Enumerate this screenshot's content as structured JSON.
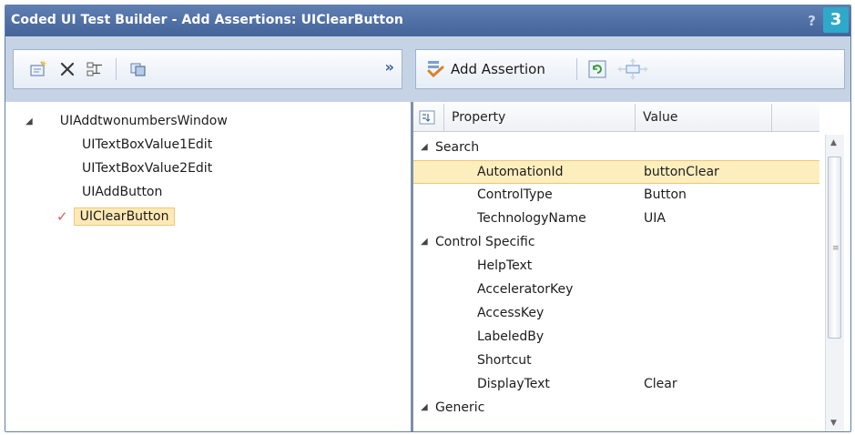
{
  "window": {
    "title": "Coded UI Test Builder - Add Assertions: UIClearButton",
    "help_label": "?",
    "step_badge": "3"
  },
  "toolbar": {
    "overflow_label": "»",
    "add_assertion_label": "Add Assertion"
  },
  "tree": {
    "root": {
      "label": "UIAddtwonumbersWindow",
      "expander": "◢"
    },
    "children": [
      {
        "label": "UITextBoxValue1Edit"
      },
      {
        "label": "UITextBoxValue2Edit"
      },
      {
        "label": "UIAddButton"
      },
      {
        "label": "UIClearButton",
        "selected": true,
        "check": "✓"
      }
    ]
  },
  "grid": {
    "columns": {
      "property": "Property",
      "value": "Value"
    },
    "rows": [
      {
        "kind": "category",
        "name": "Search",
        "expander": "◢"
      },
      {
        "kind": "property",
        "name": "AutomationId",
        "value": "buttonClear",
        "selected": true
      },
      {
        "kind": "property",
        "name": "ControlType",
        "value": "Button"
      },
      {
        "kind": "property",
        "name": "TechnologyName",
        "value": "UIA"
      },
      {
        "kind": "category",
        "name": "Control Specific",
        "expander": "◢"
      },
      {
        "kind": "property",
        "name": "HelpText",
        "value": ""
      },
      {
        "kind": "property",
        "name": "AcceleratorKey",
        "value": ""
      },
      {
        "kind": "property",
        "name": "AccessKey",
        "value": ""
      },
      {
        "kind": "property",
        "name": "LabeledBy",
        "value": ""
      },
      {
        "kind": "property",
        "name": "Shortcut",
        "value": ""
      },
      {
        "kind": "property",
        "name": "DisplayText",
        "value": "Clear"
      },
      {
        "kind": "category",
        "name": "Generic",
        "expander": "◢"
      }
    ]
  },
  "scrollbar": {
    "up": "▲",
    "grip": "≡",
    "down": "▼"
  },
  "colors": {
    "titlebar": "#4f6fa5",
    "toolbar_bg": "#c6d3e5",
    "selection": "#fdeebd",
    "badge": "#2fa9c9",
    "check": "#e05a5a"
  }
}
